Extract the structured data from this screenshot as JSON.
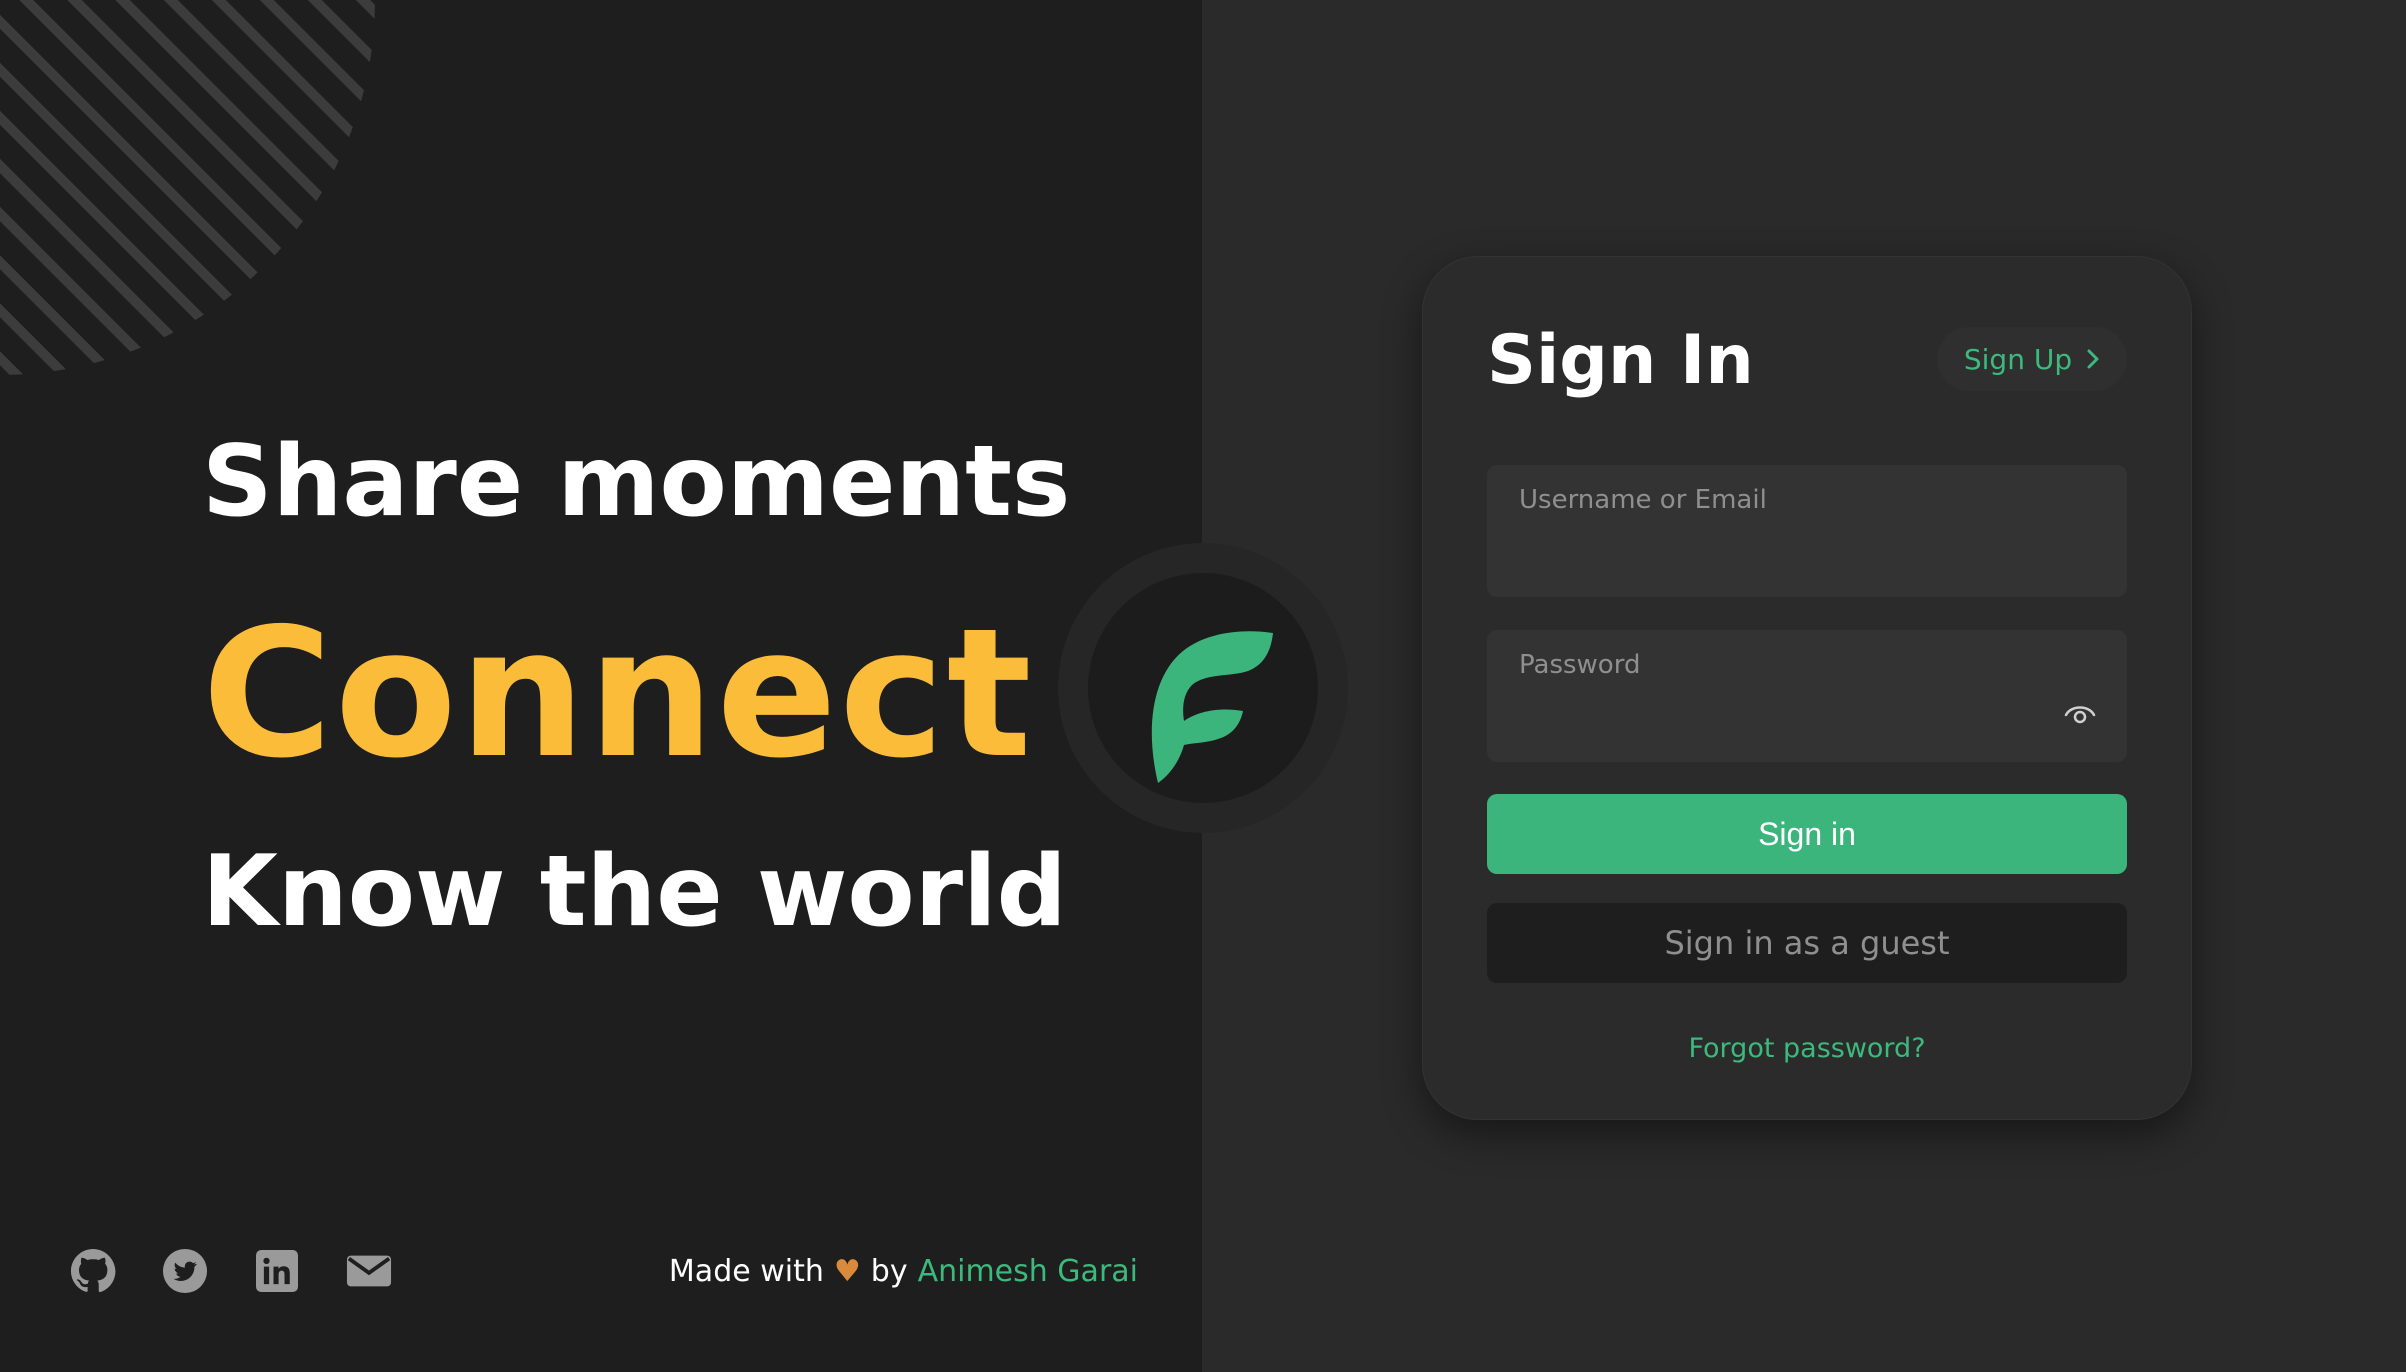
{
  "hero": {
    "line1": "Share moments",
    "line2": "Connect",
    "line3": "Know the world"
  },
  "footer": {
    "made_with": "Made with",
    "heart": "♥",
    "by": "by",
    "author": "Animesh Garai",
    "social_icons": [
      "github-icon",
      "twitter-icon",
      "linkedin-icon",
      "mail-icon"
    ]
  },
  "signin": {
    "title": "Sign In",
    "signup_label": "Sign Up",
    "username_label": "Username or Email",
    "username_value": "",
    "password_label": "Password",
    "password_value": "",
    "submit_label": "Sign in",
    "guest_label": "Sign in as a guest",
    "forgot_label": "Forgot password?"
  },
  "colors": {
    "accent_green": "#3cb57c",
    "accent_yellow": "#fbbd39",
    "left_bg": "#1e1e1e",
    "right_bg": "#2a2a2a"
  }
}
